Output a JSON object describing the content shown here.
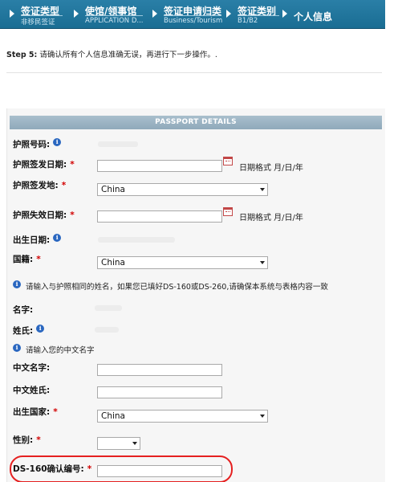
{
  "steps": [
    {
      "title": "签证类型",
      "subtitle": "非移民签证"
    },
    {
      "title": "使馆/领事馆",
      "subtitle": "APPLICATION D..."
    },
    {
      "title": "签证申请归类",
      "subtitle": "Business/Tourism"
    },
    {
      "title": "签证类别",
      "subtitle": "B1/B2"
    },
    {
      "title": "个人信息",
      "subtitle": ""
    }
  ],
  "instruction": {
    "prefix": "Step 5:",
    "text": " 请确认所有个人信息准确无误，再进行下一步操作。."
  },
  "section_title": "PASSPORT DETAILS",
  "fields": {
    "passport_number": {
      "label": "护照号码:"
    },
    "issue_date": {
      "label": "护照签发日期:",
      "format": "日期格式 月/日/年"
    },
    "issue_place": {
      "label": "护照签发地:",
      "value": "China"
    },
    "expiry_date": {
      "label": "护照失效日期:",
      "format": "日期格式 月/日/年"
    },
    "birth_date": {
      "label": "出生日期:"
    },
    "nationality": {
      "label": "国籍:",
      "value": "China"
    },
    "given_name": {
      "label": "名字:"
    },
    "surname": {
      "label": "姓氏:"
    },
    "chinese_given_name": {
      "label": "中文名字:"
    },
    "chinese_surname": {
      "label": "中文姓氏:"
    },
    "birth_country": {
      "label": "出生国家:",
      "value": "China"
    },
    "gender": {
      "label": "性别:"
    },
    "ds160_number": {
      "label": "DS-160确认编号:"
    }
  },
  "notes": {
    "name_match": "请输入与护照相同的姓名，如果您已填好DS-160或DS-260,请确保本系统与表格内容一致",
    "chinese_name": "请输入您的中文名字"
  },
  "required_mark": "*",
  "info_icon": "info-icon",
  "calendar_icon": "calendar-icon",
  "colors": {
    "header": "#1f7399",
    "required": "#d20000",
    "highlight": "#e52020",
    "info": "#2a67c0"
  }
}
